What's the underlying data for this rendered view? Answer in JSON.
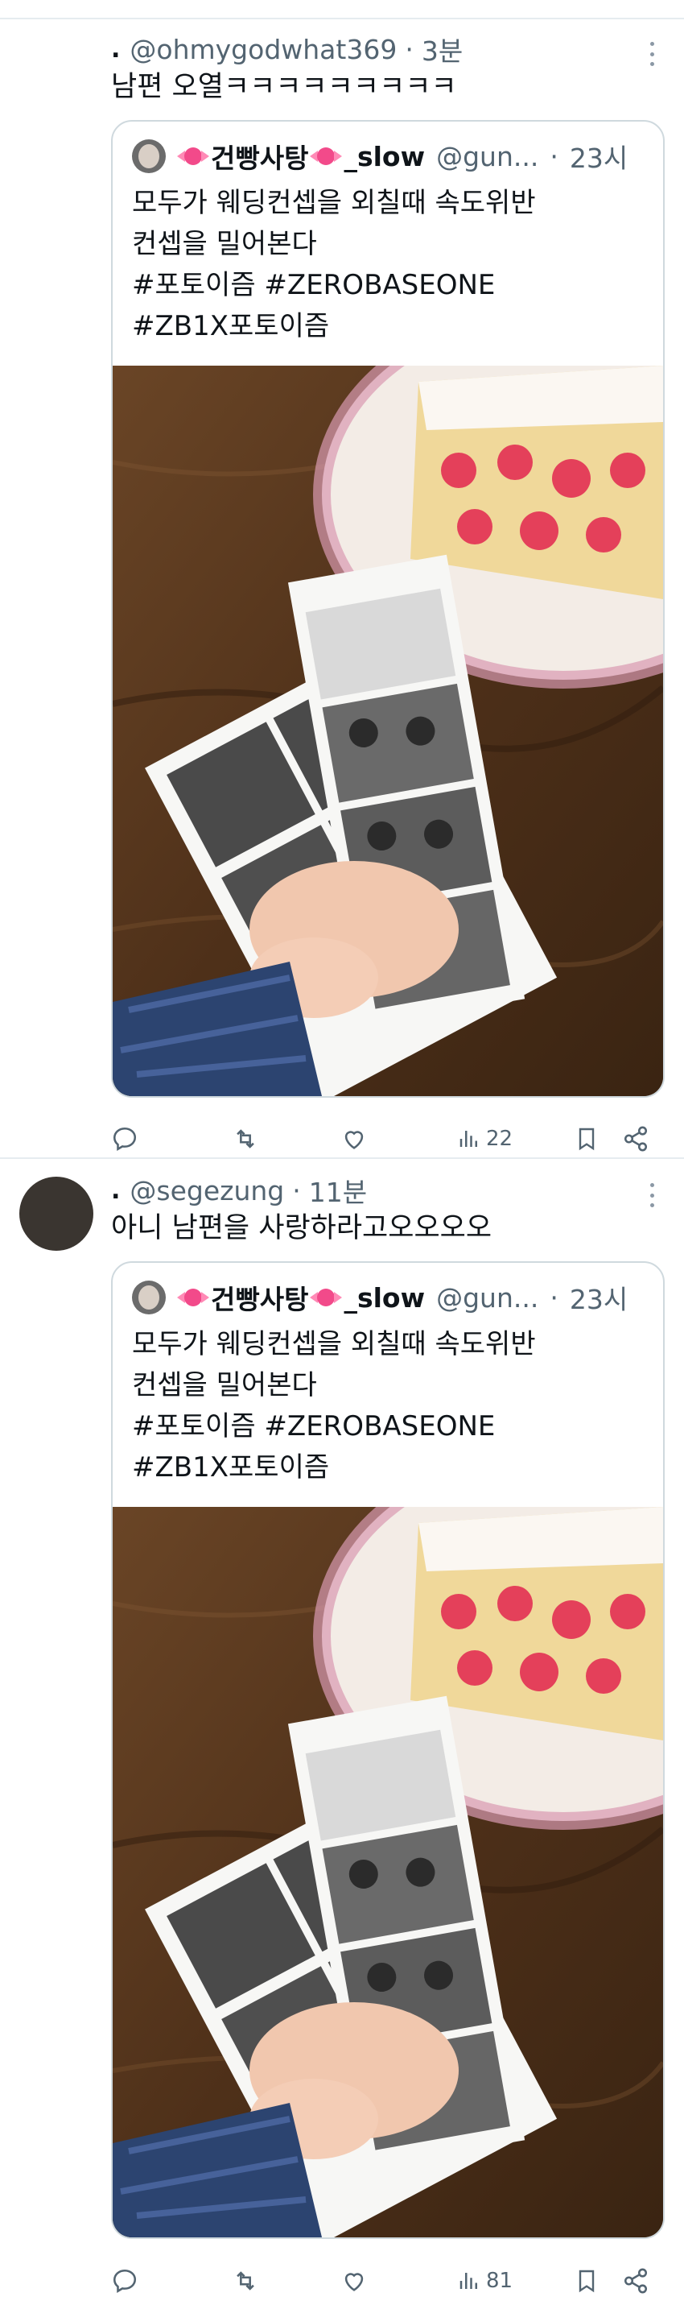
{
  "tweets": [
    {
      "handle": "@ohmygodwhat369",
      "time": "3분",
      "text": "남편 오열ㅋㅋㅋㅋㅋㅋㅋㅋㅋ",
      "quote": {
        "name": "건빵사탕",
        "name_suffix": "_slow",
        "handle": "@gun...",
        "time": "23시",
        "lines": [
          "모두가 웨딩컨셉을 외칠때 속도위반",
          "컨셉을 밀어본다",
          "#포토이즘 #ZEROBASEONE",
          "#ZB1X포토이즘"
        ]
      },
      "views": "22"
    },
    {
      "handle": "@segezung",
      "time": "11분",
      "text": "아니 남편을 사랑하라고오오오오",
      "quote": {
        "name": "건빵사탕",
        "name_suffix": "_slow",
        "handle": "@gun...",
        "time": "23시",
        "lines": [
          "모두가 웨딩컨셉을 외칠때 속도위반",
          "컨셉을 밀어본다",
          "#포토이즘 #ZEROBASEONE",
          "#ZB1X포토이즘"
        ]
      },
      "views": "81"
    }
  ],
  "common": {
    "dot": ".",
    "sep": "·"
  }
}
